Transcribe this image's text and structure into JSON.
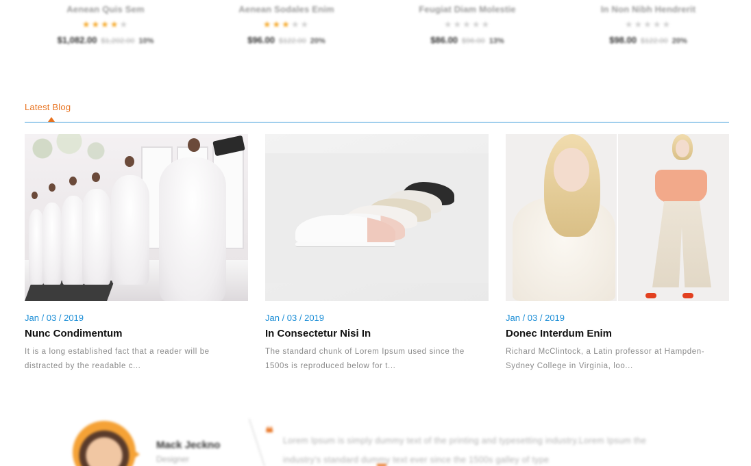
{
  "products": [
    {
      "name": "Aenean Quis Sem",
      "rating": 4,
      "price": "$1,082.00",
      "old_price": "$1,202.00",
      "discount": "10%"
    },
    {
      "name": "Aenean Sodales Enim",
      "rating": 3,
      "price": "$96.00",
      "old_price": "$122.00",
      "discount": "20%"
    },
    {
      "name": "Feugiat Diam Molestie",
      "rating": 0,
      "price": "$86.00",
      "old_price": "$96.00",
      "discount": "13%"
    },
    {
      "name": "In Non Nibh Hendrerit",
      "rating": 0,
      "price": "$98.00",
      "old_price": "$122.00",
      "discount": "20%"
    }
  ],
  "blog_section": {
    "title": "Latest Blog",
    "accent": "#e8711d",
    "line_color": "#3b9bd9"
  },
  "blog_posts": [
    {
      "date": "Jan / 03 / 2019",
      "title": "Nunc Condimentum",
      "excerpt": "It is a long established fact that a reader will be distracted by the readable c...",
      "image": "bridal-runway-image"
    },
    {
      "date": "Jan / 03 / 2019",
      "title": "In Consectetur Nisi In",
      "excerpt": "The standard chunk of Lorem Ipsum used since the 1500s is reproduced below for t...",
      "image": "white-sneakers-image"
    },
    {
      "date": "Jan / 03 / 2019",
      "title": "Donec Interdum Enim",
      "excerpt": "Richard McClintock, a Latin professor at Hampden-Sydney College in Virginia, loo...",
      "image": "fashion-models-image"
    }
  ],
  "testimonial": {
    "name": "Mack Jeckno",
    "role": "Designer",
    "quote_mark": "❝",
    "text": "Lorem Ipsum is simply dummy text of the printing and typesetting industry.Lorem Ipsum the industry's standard dummy text ever since the 1500s galley of type"
  },
  "colors": {
    "date": "#1a8dd6",
    "star_on": "#f5a623",
    "star_off": "#cfcfcf"
  }
}
